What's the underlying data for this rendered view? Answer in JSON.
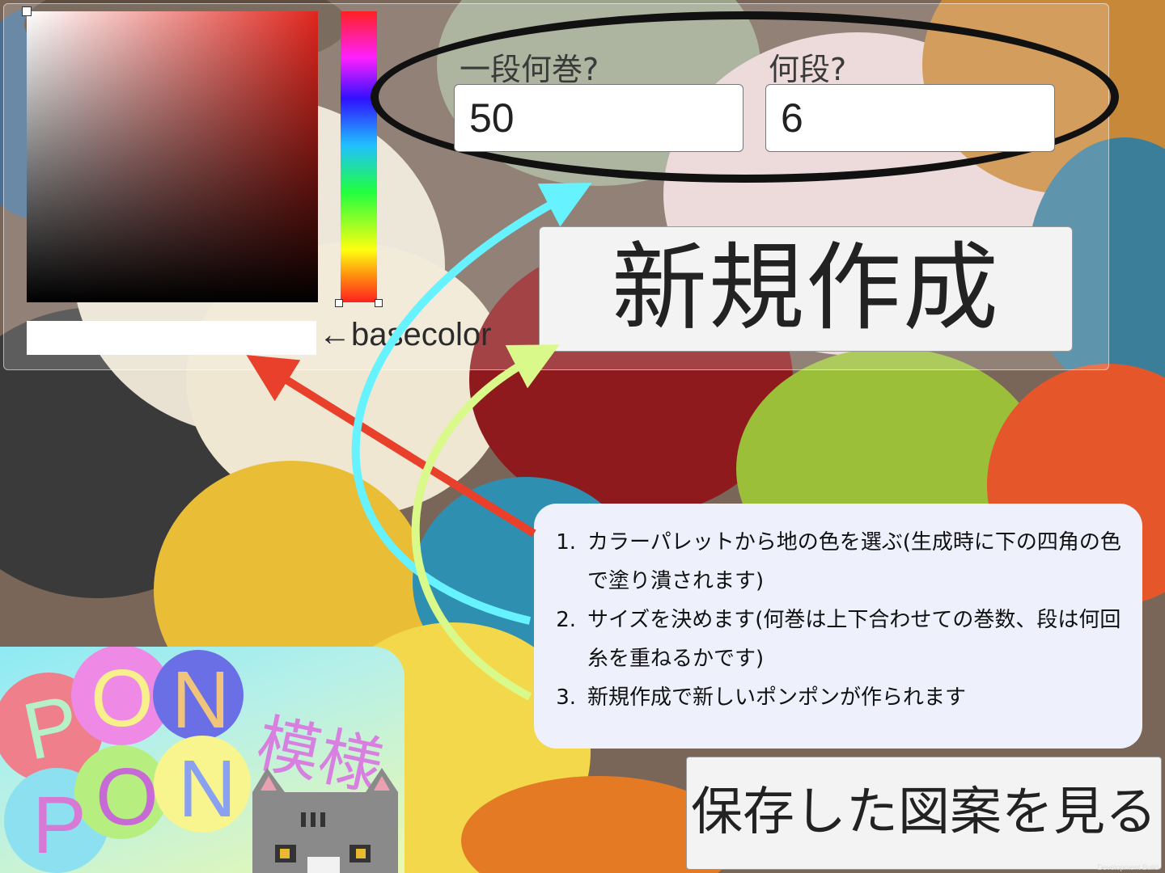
{
  "colors": {
    "panel_border": "#ffffff",
    "sv_hue": "#e0261d",
    "ellipse": "#111111",
    "arrow_red": "#e8402a",
    "arrow_cyan": "#66f2ff",
    "arrow_lime": "#d9f98a",
    "instructions_bg": "#eef0fb",
    "base_color": "#ffffff"
  },
  "color_picker": {
    "base_label": "←basecolor"
  },
  "size": {
    "rolls_label": "一段何巻?",
    "rolls_value": "50",
    "rows_label": "何段?",
    "rows_value": "6"
  },
  "buttons": {
    "new": "新規作成",
    "saved": "保存した図案を見る"
  },
  "instructions": [
    {
      "num": "1.",
      "text": "カラーパレットから地の色を選ぶ(生成時に下の四角の色で塗り潰されます)"
    },
    {
      "num": "2.",
      "text": "サイズを決めます(何巻は上下合わせての巻数、段は何回糸を重ねるかです)"
    },
    {
      "num": "3.",
      "text": "新規作成で新しいポンポンが作られます"
    }
  ],
  "logo": {
    "pon1": [
      "P",
      "O",
      "N"
    ],
    "pon2": [
      "P",
      "O",
      "N"
    ],
    "kanji": "模様"
  },
  "footer": {
    "dev_build": "Development Build"
  }
}
